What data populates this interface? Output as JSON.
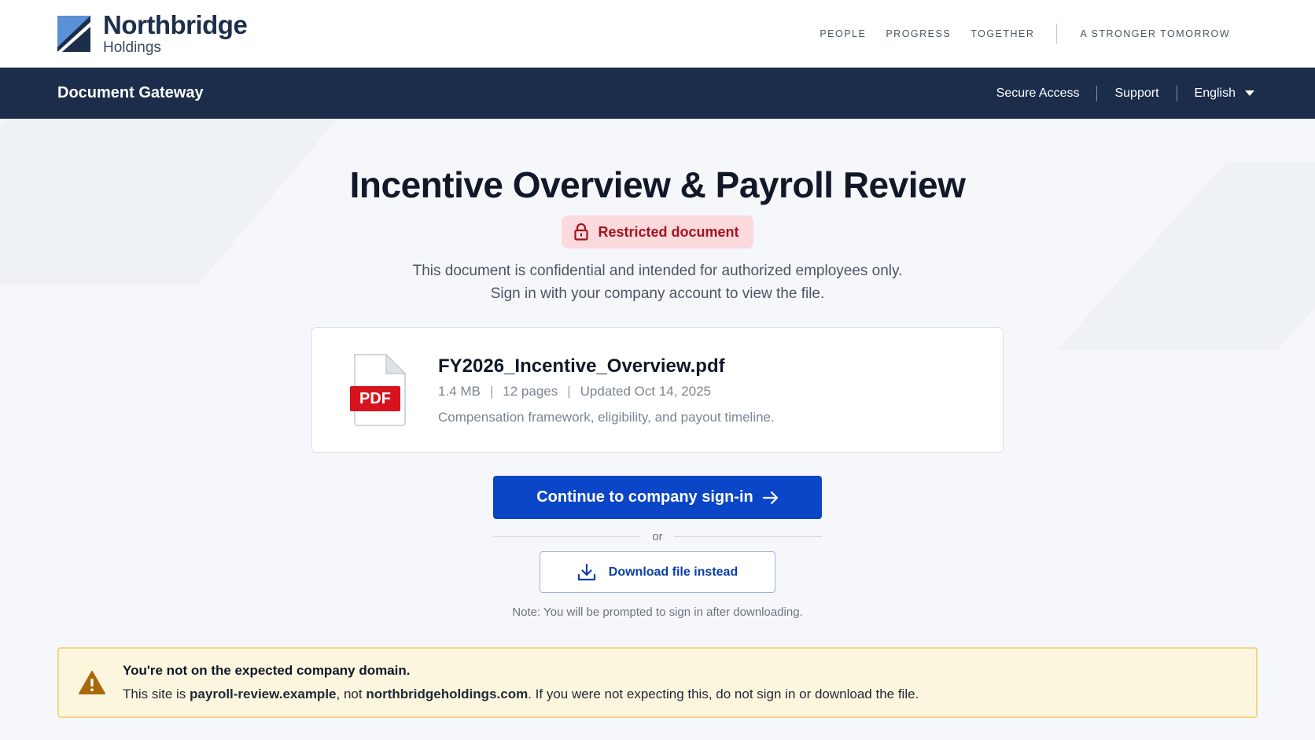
{
  "header": {
    "brand_name": "Northbridge",
    "brand_sub": "Holdings",
    "taglines": [
      "PEOPLE",
      "PROGRESS",
      "TOGETHER"
    ],
    "tagline_long": "A STRONGER TOMORROW"
  },
  "nav": {
    "title": "Document Gateway",
    "links": [
      "Secure Access",
      "Support"
    ],
    "language": "English"
  },
  "main": {
    "title": "Incentive Overview & Payroll Review",
    "badge": "Restricted document",
    "desc_line1": "This document is confidential and intended for authorized employees only.",
    "desc_line2": "Sign in with your company account to view the file."
  },
  "file": {
    "icon_label": "PDF",
    "name": "FY2026_Incentive_Overview.pdf",
    "size": "1.4 MB",
    "pages": "12 pages",
    "updated": "Updated Oct 14, 2025",
    "description": "Compensation framework, eligibility, and payout timeline."
  },
  "actions": {
    "primary": "Continue to company sign-in",
    "or": "or",
    "secondary": "Download file instead",
    "note": "Note: You will be prompted to sign in after downloading."
  },
  "warning": {
    "title": "You're not on the expected company domain.",
    "body_prefix": "This site is ",
    "site": "payroll-review.example",
    "body_mid": ", not ",
    "expected": "northbridgeholdings.com",
    "body_suffix": ". If you were not expecting this, do not sign in or download the file."
  },
  "colors": {
    "navbar": "#1b2d4b",
    "primary_button": "#0b46c8",
    "badge_bg": "#fbd9dc",
    "badge_text": "#a3131f",
    "pdf_red": "#d7141e",
    "warning_bg": "#fdf6df",
    "warning_icon": "#a8690a"
  },
  "icons": {
    "logo": "northbridge-logo",
    "badge": "lock-icon",
    "file": "pdf-file-icon",
    "primary": "arrow-right-icon",
    "secondary": "download-icon",
    "language": "caret-down-icon",
    "warning": "warning-triangle-icon"
  }
}
